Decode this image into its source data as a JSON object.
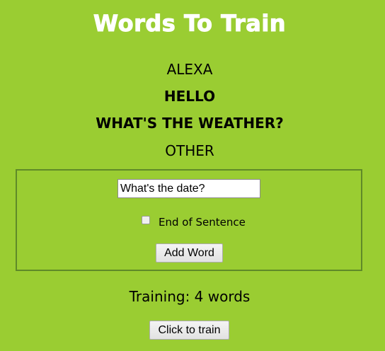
{
  "page": {
    "title": "Words To Train",
    "background_color": "#9acd32"
  },
  "words": [
    {
      "text": "ALEXA",
      "bold": false
    },
    {
      "text": "HELLO",
      "bold": true
    },
    {
      "text": "WHAT'S THE WEATHER?",
      "bold": true
    },
    {
      "text": "OTHER",
      "bold": false
    }
  ],
  "form": {
    "word_input_value": "What's the date?",
    "end_of_sentence_label": "End of Sentence",
    "end_of_sentence_checked": false,
    "add_button_label": "Add Word"
  },
  "training": {
    "status_text": "Training: 4 words",
    "train_button_label": "Click to train"
  }
}
